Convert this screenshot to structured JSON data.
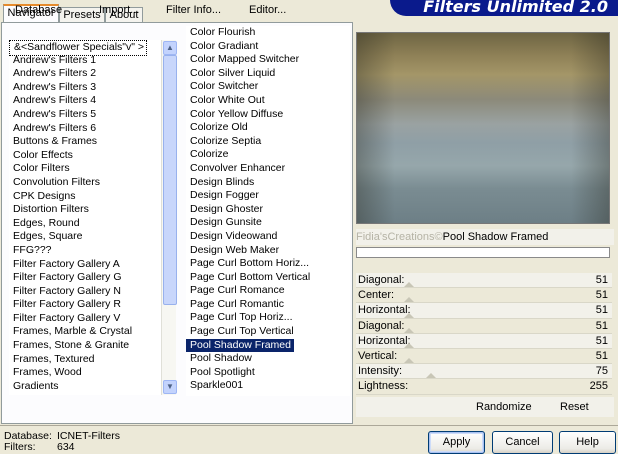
{
  "window": {
    "title": "Filters Unlimited 2.0"
  },
  "tabs": [
    {
      "label": "Navigator",
      "active": true
    },
    {
      "label": "Presets",
      "active": false
    },
    {
      "label": "About",
      "active": false
    }
  ],
  "categories": {
    "items": [
      "&<Sandflower Specials\"v\" >",
      "Andrew's Filters 1",
      "Andrew's Filters 2",
      "Andrew's Filters 3",
      "Andrew's Filters 4",
      "Andrew's Filters 5",
      "Andrew's Filters 6",
      "Buttons & Frames",
      "Color Effects",
      "Color Filters",
      "Convolution Filters",
      "CPK Designs",
      "Distortion Filters",
      "Edges, Round",
      "Edges, Square",
      "FFG???",
      "Filter Factory Gallery A",
      "Filter Factory Gallery G",
      "Filter Factory Gallery N",
      "Filter Factory Gallery R",
      "Filter Factory Gallery V",
      "Frames, Marble & Crystal",
      "Frames, Stone & Granite",
      "Frames, Textured",
      "Frames, Wood",
      "Gradients"
    ],
    "scroll_position": 0.0
  },
  "filters": {
    "items": [
      "Color Flourish",
      "Color Gradiant",
      "Color Mapped Switcher",
      "Color Silver Liquid",
      "Color Switcher",
      "Color White Out",
      "Color Yellow Diffuse",
      "Colorize Old",
      "Colorize Septia",
      "Colorize",
      "Convolver Enhancer",
      "Design Blinds",
      "Design Fogger",
      "Design Ghoster",
      "Design Gunsite",
      "Design Videowand",
      "Design Web Maker",
      "Page Curl Bottom Horiz...",
      "Page Curl Bottom Vertical",
      "Page Curl Romance",
      "Page Curl Romantic",
      "Page Curl Top Horiz...",
      "Page Curl Top Vertical",
      "Pool Shadow Framed",
      "Pool Shadow",
      "Pool Spotlight",
      "Sparkle001"
    ],
    "selected": "Pool Shadow Framed"
  },
  "toolbar": {
    "database": "Database",
    "import": "Import...",
    "filter_info": "Filter Info...",
    "editor": "Editor..."
  },
  "preview": {
    "author": "Fidia'sCreations©",
    "filter_name": "Pool Shadow Framed"
  },
  "sliders": [
    {
      "label": "Diagonal:",
      "value": "51",
      "level": 0.2
    },
    {
      "label": "Center:",
      "value": "51",
      "level": 0.2
    },
    {
      "label": "Horizontal:",
      "value": "51",
      "level": 0.2
    },
    {
      "label": "Diagonal:",
      "value": "51",
      "level": 0.2
    },
    {
      "label": "Horizontal:",
      "value": "51",
      "level": 0.2
    },
    {
      "label": "Vertical:",
      "value": "51",
      "level": 0.2
    },
    {
      "label": "Intensity:",
      "value": "75",
      "level": 0.29
    },
    {
      "label": "Lightness:",
      "value": "255",
      "level": 1.0
    }
  ],
  "right_buttons": {
    "randomize": "Randomize",
    "reset": "Reset"
  },
  "status": {
    "database_label": "Database:",
    "database_value": "ICNET-Filters",
    "filters_label": "Filters:",
    "filters_value": "634"
  },
  "dialog": {
    "apply": "Apply",
    "cancel": "Cancel",
    "help": "Help"
  },
  "colors": {
    "header_blue": "#0a1a8c",
    "selection": "#0a246a",
    "tab_accent": "#e68b2c"
  }
}
